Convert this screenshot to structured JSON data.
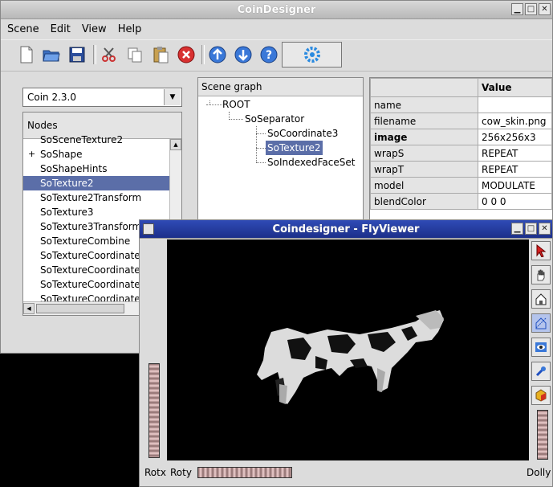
{
  "main_window": {
    "title": "CoinDesigner",
    "menu": [
      "Scene",
      "Edit",
      "View",
      "Help"
    ],
    "toolbar_icons": [
      "new-file-icon",
      "open-folder-icon",
      "save-icon",
      "cut-icon",
      "copy-icon",
      "paste-icon",
      "delete-icon",
      "move-up-icon",
      "move-down-icon",
      "help-icon",
      "settings-icon"
    ]
  },
  "library_select": {
    "value": "Coin 2.3.0"
  },
  "nodes_panel": {
    "header": "Nodes",
    "items": [
      {
        "label": "SoSceneTexture2",
        "expandable": false
      },
      {
        "label": "SoShape",
        "expandable": true
      },
      {
        "label": "SoShapeHints",
        "expandable": false
      },
      {
        "label": "SoTexture2",
        "expandable": false,
        "selected": true
      },
      {
        "label": "SoTexture2Transform",
        "expandable": false
      },
      {
        "label": "SoTexture3",
        "expandable": false
      },
      {
        "label": "SoTexture3Transform",
        "expandable": false
      },
      {
        "label": "SoTextureCombine",
        "expandable": false
      },
      {
        "label": "SoTextureCoordinate",
        "expandable": false
      },
      {
        "label": "SoTextureCoordinate",
        "expandable": false
      },
      {
        "label": "SoTextureCoordinate",
        "expandable": false
      },
      {
        "label": "SoTextureCoordinate",
        "expandable": false
      }
    ]
  },
  "scene_graph": {
    "header": "Scene graph",
    "root": "ROOT",
    "separator": "SoSeparator",
    "children": [
      "SoCoordinate3",
      "SoTexture2",
      "SoIndexedFaceSet"
    ],
    "selected": "SoTexture2"
  },
  "properties": {
    "header_value": "Value",
    "rows": [
      {
        "name": "name",
        "value": "",
        "bold": false
      },
      {
        "name": "filename",
        "value": "cow_skin.png",
        "bold": false
      },
      {
        "name": "image",
        "value": "256x256x3",
        "bold": true
      },
      {
        "name": "wrapS",
        "value": "REPEAT",
        "bold": false
      },
      {
        "name": "wrapT",
        "value": "REPEAT",
        "bold": false
      },
      {
        "name": "model",
        "value": "MODULATE",
        "bold": false
      },
      {
        "name": "blendColor",
        "value": "0 0 0",
        "bold": false
      }
    ]
  },
  "fly_viewer": {
    "title": "Coindesigner - FlyViewer",
    "rotx_label": "Rotx",
    "roty_label": "Roty",
    "dolly_label": "Dolly",
    "side_buttons": [
      "pick-arrow-icon",
      "hand-view-icon",
      "home-icon",
      "set-home-icon",
      "view-all-icon",
      "seek-icon",
      "perspective-icon"
    ]
  }
}
